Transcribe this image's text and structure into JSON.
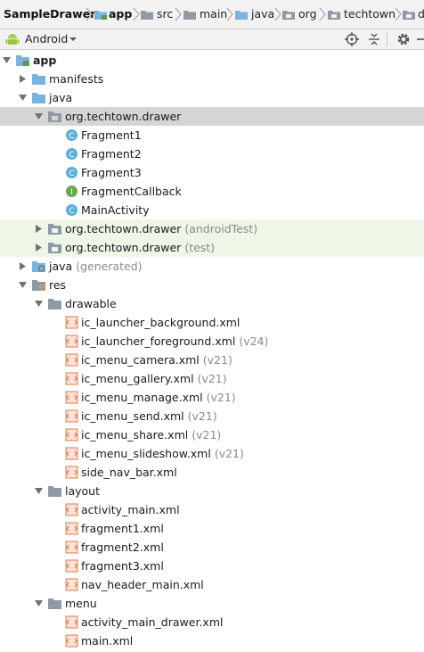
{
  "breadcrumb": {
    "project": "SampleDrawer",
    "module": "app",
    "src": "src",
    "main": "main",
    "java": "java",
    "org": "org",
    "techtown": "techtown",
    "overflow": "d"
  },
  "toolbar": {
    "view_mode": "Android"
  },
  "tree": {
    "app": "app",
    "manifests": "manifests",
    "java": "java",
    "package_main": "org.techtown.drawer",
    "class_fragment1": "Fragment1",
    "class_fragment2": "Fragment2",
    "class_fragment3": "Fragment3",
    "interface_callback": "FragmentCallback",
    "class_main_activity": "MainActivity",
    "package_android_test": "org.techtown.drawer",
    "package_android_test_suffix": "(androidTest)",
    "package_test": "org.techtown.drawer",
    "package_test_suffix": "(test)",
    "java_generated": "java",
    "java_generated_suffix": "(generated)",
    "res": "res",
    "drawable": "drawable",
    "drawable_items": [
      {
        "name": "ic_launcher_background.xml",
        "suffix": ""
      },
      {
        "name": "ic_launcher_foreground.xml",
        "suffix": "(v24)"
      },
      {
        "name": "ic_menu_camera.xml",
        "suffix": "(v21)"
      },
      {
        "name": "ic_menu_gallery.xml",
        "suffix": "(v21)"
      },
      {
        "name": "ic_menu_manage.xml",
        "suffix": "(v21)"
      },
      {
        "name": "ic_menu_send.xml",
        "suffix": "(v21)"
      },
      {
        "name": "ic_menu_share.xml",
        "suffix": "(v21)"
      },
      {
        "name": "ic_menu_slideshow.xml",
        "suffix": "(v21)"
      },
      {
        "name": "side_nav_bar.xml",
        "suffix": ""
      }
    ],
    "layout": "layout",
    "layout_items": [
      {
        "name": "activity_main.xml"
      },
      {
        "name": "fragment1.xml"
      },
      {
        "name": "fragment2.xml"
      },
      {
        "name": "fragment3.xml"
      },
      {
        "name": "nav_header_main.xml"
      }
    ],
    "menu": "menu",
    "menu_items": [
      {
        "name": "activity_main_drawer.xml"
      },
      {
        "name": "main.xml"
      }
    ]
  },
  "colors": {
    "selection": "#d5d5d5",
    "test_source_bg": "#eef6e8",
    "folder_blue": "#7bb3dd",
    "class_badge": "#5ab0d8",
    "interface_badge": "#6aa84f",
    "xml_badge": "#e07a4f"
  }
}
